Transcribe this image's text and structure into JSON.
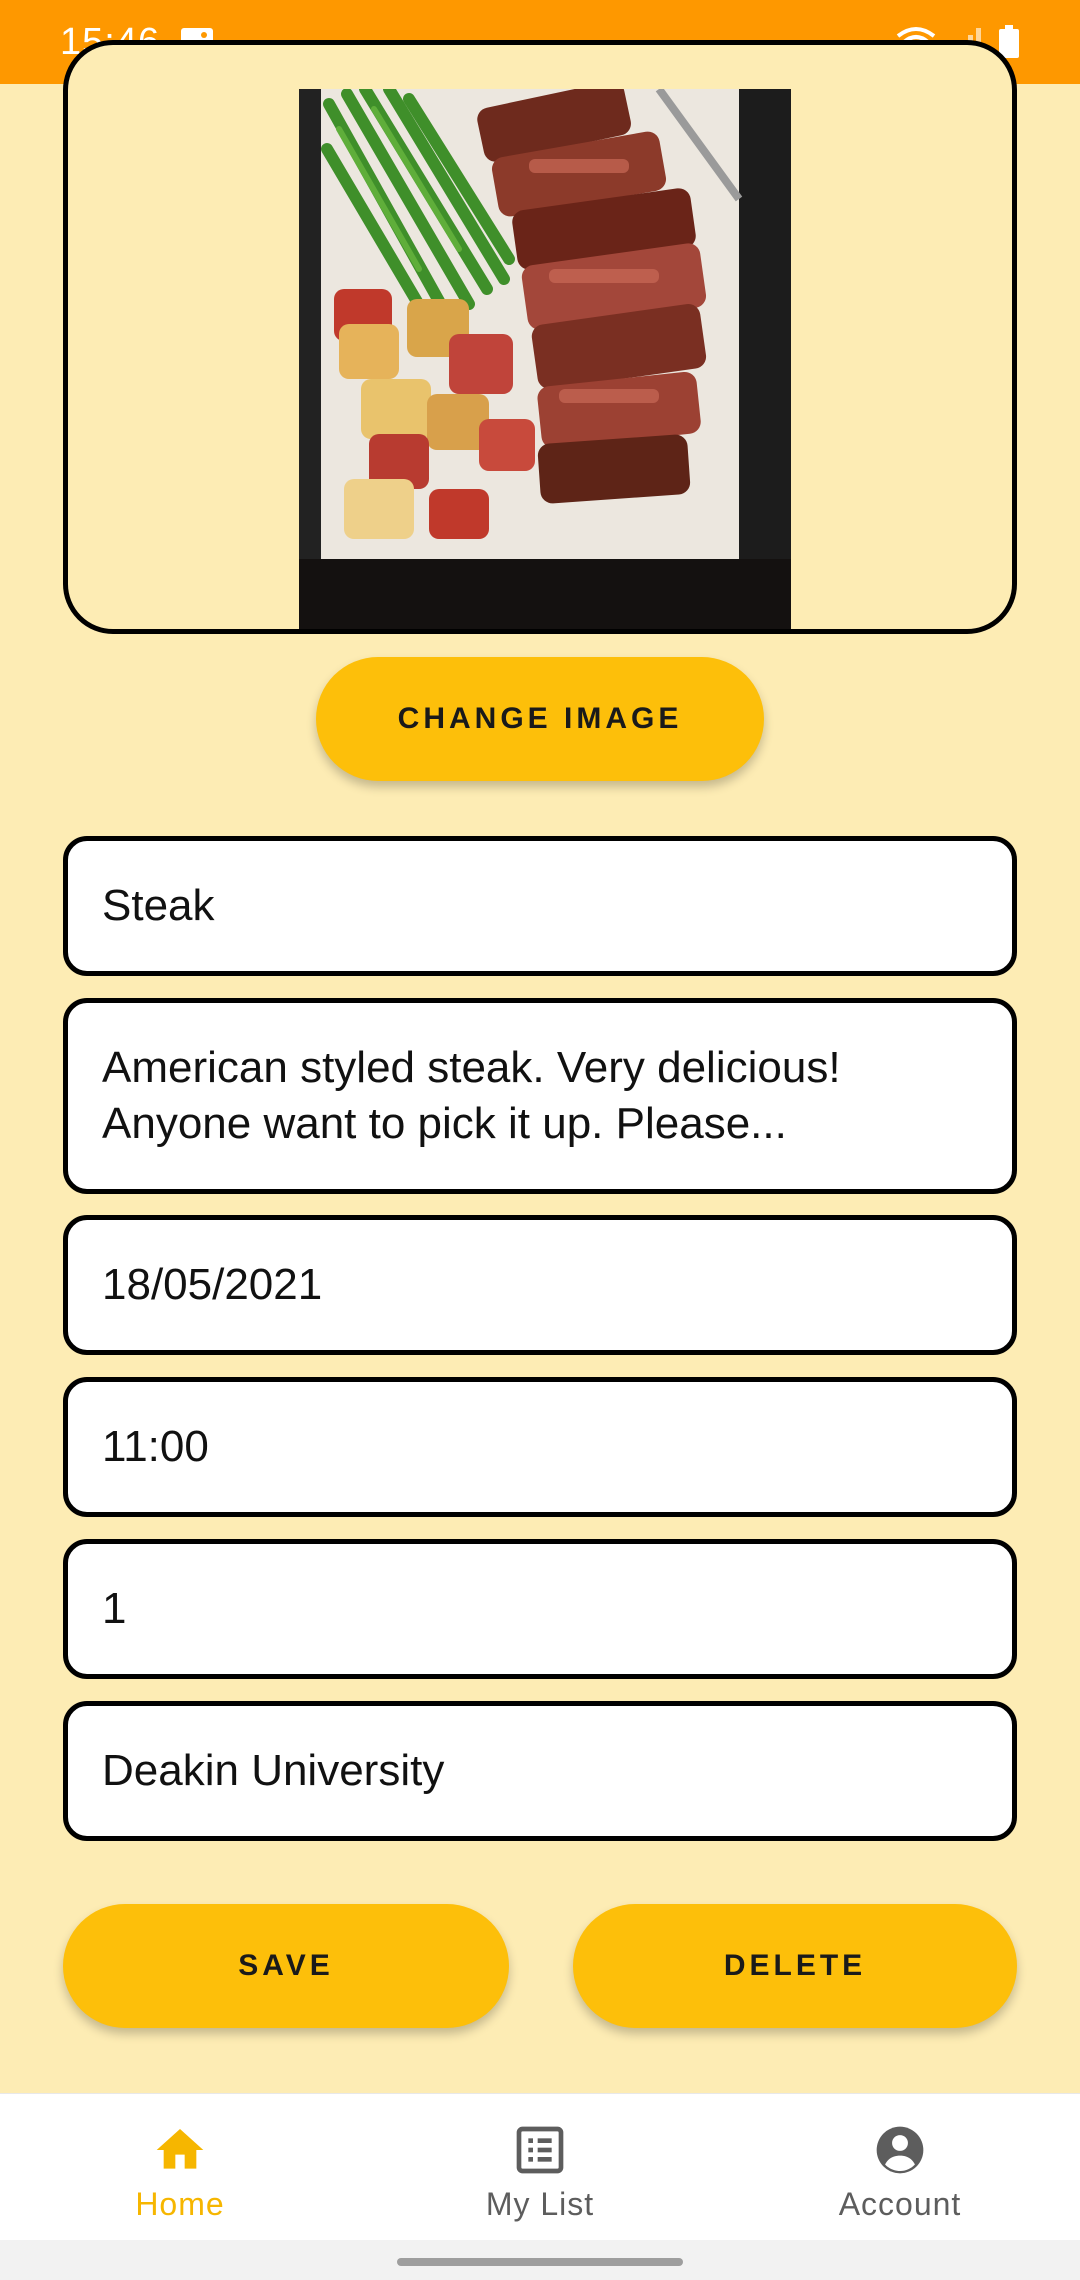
{
  "status_bar": {
    "time": "15:46",
    "icons": [
      "gallery-icon",
      "wifi-icon",
      "signal-icon",
      "battery-icon"
    ]
  },
  "item": {
    "image": "steak-photo",
    "change_image_label": "CHANGE IMAGE",
    "name": "Steak",
    "description_line1": "American styled steak. Very delicious!",
    "description_line2": "Anyone want to pick it up. Please...",
    "date": "18/05/2021",
    "time": "11:00",
    "quantity": "1",
    "location": "Deakin University"
  },
  "actions": {
    "save_label": "SAVE",
    "delete_label": "DELETE"
  },
  "bottom_nav": {
    "items": [
      {
        "label": "Home",
        "icon": "home-icon",
        "active": true
      },
      {
        "label": "My List",
        "icon": "list-icon",
        "active": false
      },
      {
        "label": "Account",
        "icon": "account-icon",
        "active": false
      }
    ]
  },
  "colors": {
    "status_bar": "#FE9800",
    "background": "#FDECB4",
    "accent": "#FDBF0A",
    "nav_active": "#F6B600"
  }
}
